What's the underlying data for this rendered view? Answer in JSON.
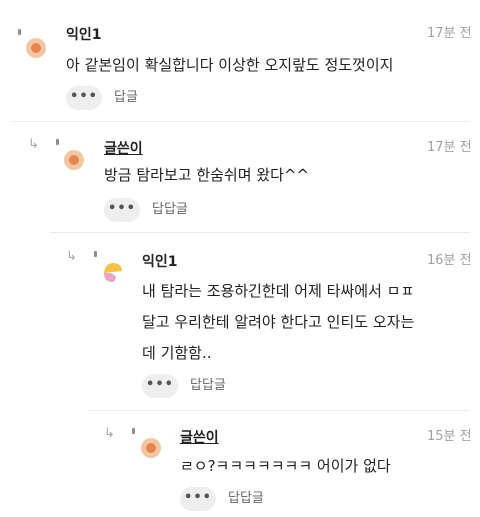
{
  "more_label": "•••",
  "reply_arrow_glyph": "↳",
  "comments": [
    {
      "nick": "익인1",
      "time": "17분 전",
      "lines": [
        "아 같본임이 확실합니다 이상한 오지랖도 정도껏이지"
      ],
      "reply_label": "답글"
    },
    {
      "nick": "글쓴이",
      "time": "17분 전",
      "lines": [
        "방금 탐라보고 한숨쉬며 왔다^^"
      ],
      "reply_label": "답답글"
    },
    {
      "nick": "익인1",
      "time": "16분 전",
      "lines": [
        "내 탐라는 조용하긴한데 어제 타싸에서 ㅁㅍ",
        "달고 우리한테 알려야 한다고 인티도 오자는",
        "데 기함함.."
      ],
      "reply_label": "답답글"
    },
    {
      "nick": "글쓴이",
      "time": "15분 전",
      "lines": [
        "ㄹㅇ?ㅋㅋㅋㅋㅋㅋㅋ 어이가 없다"
      ],
      "reply_label": "답답글"
    }
  ],
  "colors": {
    "avatar_outer": "#f3c6a3",
    "avatar_inner": "#e6864e",
    "avatar_alt_yellow": "#f5c341",
    "avatar_alt_pink": "#e9a6c6",
    "time_text": "#a0a0a0",
    "button_bg": "#eeeeee"
  },
  "icons": {
    "reply": "reply-arrow-icon",
    "avatar": "avatar-icon",
    "more": "more-dots-icon"
  }
}
